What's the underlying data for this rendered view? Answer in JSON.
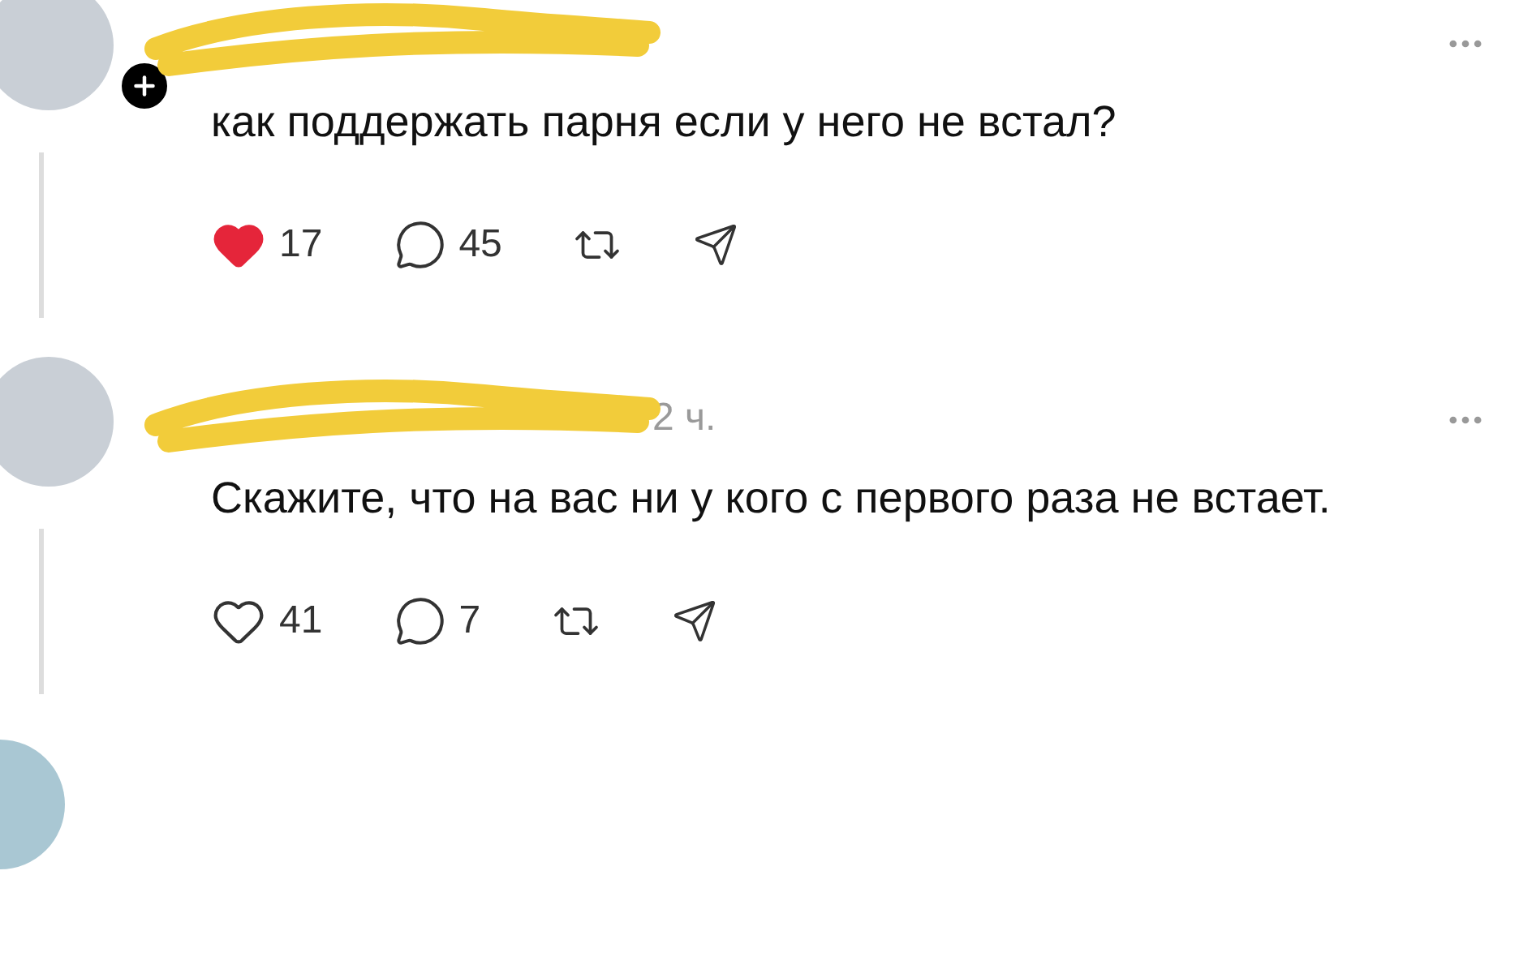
{
  "posts": [
    {
      "follow_badge": true,
      "text": "как поддержать парня если у него не встал?",
      "liked": true,
      "likes": "17",
      "comments": "45"
    },
    {
      "time": "2 ч.",
      "follow_badge": false,
      "text": "Скажите, что на вас ни у кого с первого раза не встает.",
      "liked": false,
      "likes": "41",
      "comments": "7"
    }
  ]
}
